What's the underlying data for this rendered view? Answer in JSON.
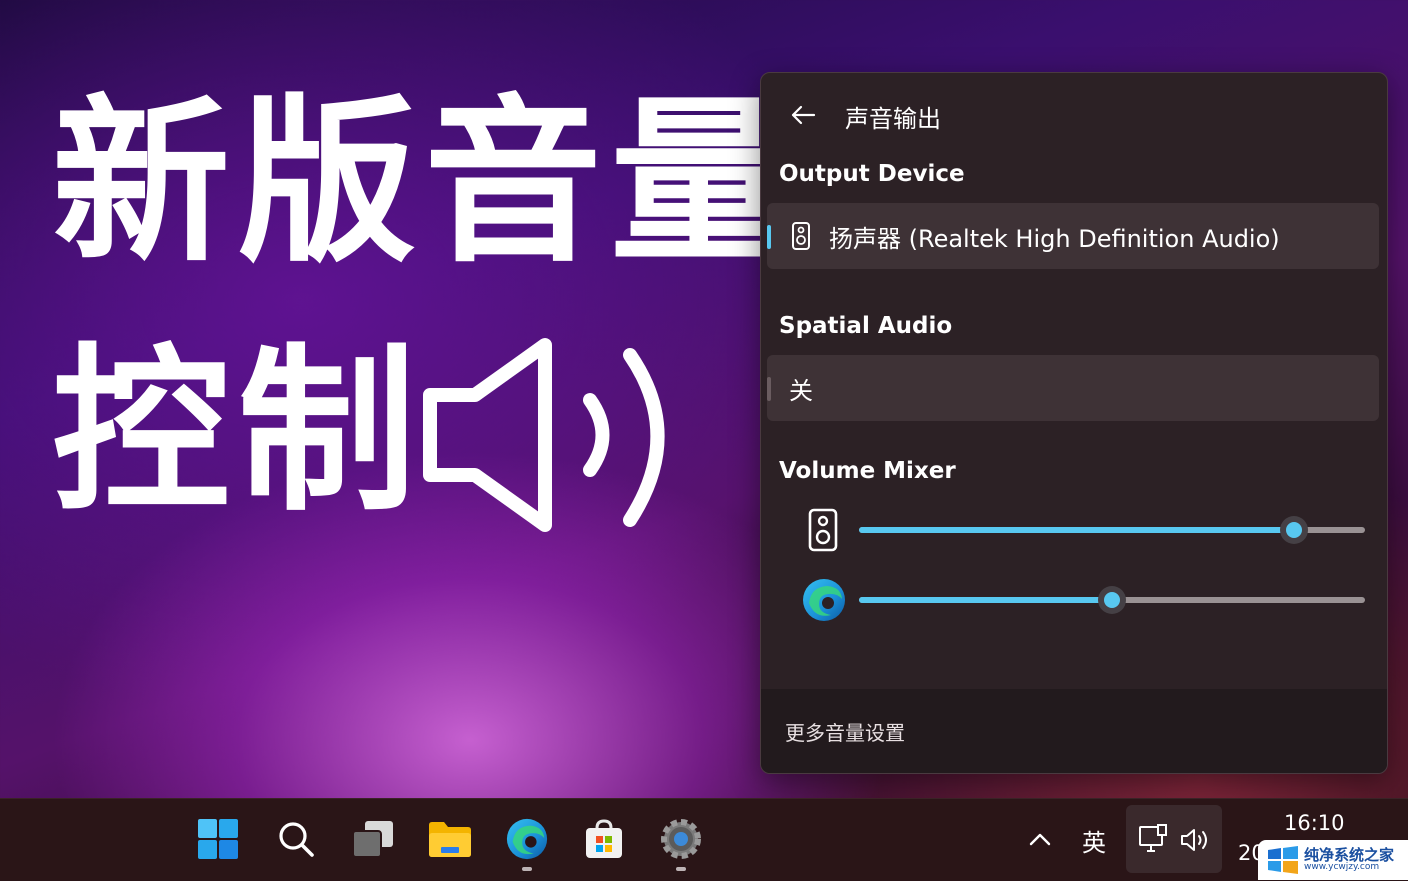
{
  "hero": {
    "line1": "新版音量",
    "line2": "控制"
  },
  "panel": {
    "title": "声音输出",
    "output_device": {
      "heading": "Output Device",
      "selected": "扬声器 (Realtek High Definition Audio)"
    },
    "spatial_audio": {
      "heading": "Spatial Audio",
      "value": "关"
    },
    "volume_mixer": {
      "heading": "Volume Mixer",
      "items": [
        {
          "app": "speaker-icon",
          "level": 0.86
        },
        {
          "app": "edge-icon",
          "level": 0.5
        }
      ]
    },
    "footer_link": "更多音量设置"
  },
  "taskbar": {
    "icons": [
      "windows-start-icon",
      "search-icon",
      "task-view-icon",
      "file-explorer-icon",
      "edge-icon",
      "store-icon",
      "settings-icon"
    ],
    "tray": {
      "ime": "英",
      "time": "16:10",
      "date": "20"
    }
  },
  "watermark": {
    "title": "纯净系统之家",
    "subtitle": "www.ycwjzy.com"
  },
  "colors": {
    "accent": "#58c8f0",
    "panel_bg": "#2c2125",
    "row_bg": "#3e3236"
  }
}
